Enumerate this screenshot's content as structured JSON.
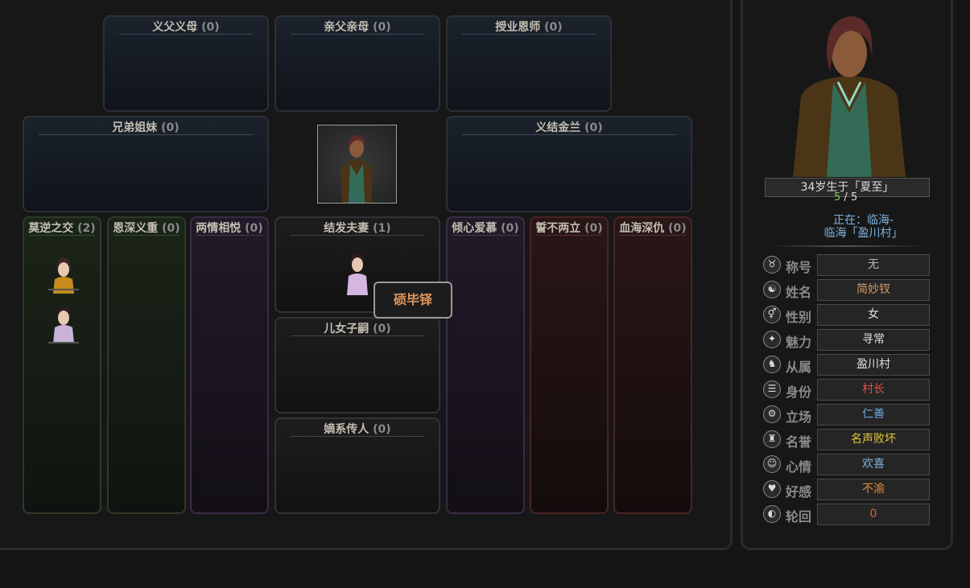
{
  "boxes": {
    "adoptive_parents": {
      "title": "义父义母",
      "count": "(0)"
    },
    "birth_parents": {
      "title": "亲父亲母",
      "count": "(0)"
    },
    "mentor": {
      "title": "授业恩师",
      "count": "(0)"
    },
    "siblings": {
      "title": "兄弟姐妹",
      "count": "(0)"
    },
    "sworn": {
      "title": "义结金兰",
      "count": "(0)"
    },
    "close_friends": {
      "title": "莫逆之交",
      "count": "(2)"
    },
    "benefactors": {
      "title": "恩深义重",
      "count": "(0)"
    },
    "mutual_love": {
      "title": "两情相悦",
      "count": "(0)"
    },
    "spouse": {
      "title": "结发夫妻",
      "count": "(1)"
    },
    "children": {
      "title": "儿女子嗣",
      "count": "(0)"
    },
    "heirs": {
      "title": "嫡系传人",
      "count": "(0)"
    },
    "admire": {
      "title": "倾心爱慕",
      "count": "(0)"
    },
    "enemies": {
      "title": "誓不两立",
      "count": "(0)"
    },
    "blood_feud": {
      "title": "血海深仇",
      "count": "(0)"
    }
  },
  "tooltip": {
    "name": "䂵毕铎"
  },
  "character": {
    "birth": "34岁生于「夏至」",
    "hp_current": "5",
    "hp_sep": " / ",
    "hp_max": "5",
    "location_line1": "正在：临海-",
    "location_line2": "临海「盈川村」"
  },
  "attributes": [
    {
      "label": "称号",
      "value": "无",
      "color": "#b8b8b8",
      "icon": "title-icon"
    },
    {
      "label": "姓名",
      "value": "简妙钗",
      "color": "#d69a6a",
      "icon": "name-icon"
    },
    {
      "label": "性别",
      "value": "女",
      "color": "#e0e0e0",
      "icon": "gender-icon"
    },
    {
      "label": "魅力",
      "value": "寻常",
      "color": "#e0e0e0",
      "icon": "charm-icon"
    },
    {
      "label": "从属",
      "value": "盈川村",
      "color": "#e0e0e0",
      "icon": "affiliation-icon"
    },
    {
      "label": "身份",
      "value": "村长",
      "color": "#e0514a",
      "icon": "status-icon"
    },
    {
      "label": "立场",
      "value": "仁善",
      "color": "#6fa8dc",
      "icon": "alignment-icon"
    },
    {
      "label": "名誉",
      "value": "名声败坏",
      "color": "#e8c93a",
      "icon": "reputation-icon"
    },
    {
      "label": "心情",
      "value": "欢喜",
      "color": "#7fb3e0",
      "icon": "mood-icon"
    },
    {
      "label": "好感",
      "value": "不渝",
      "color": "#e58a3a",
      "icon": "favor-icon"
    },
    {
      "label": "轮回",
      "value": "0",
      "color": "#e0603a",
      "icon": "reincarnation-icon"
    }
  ]
}
